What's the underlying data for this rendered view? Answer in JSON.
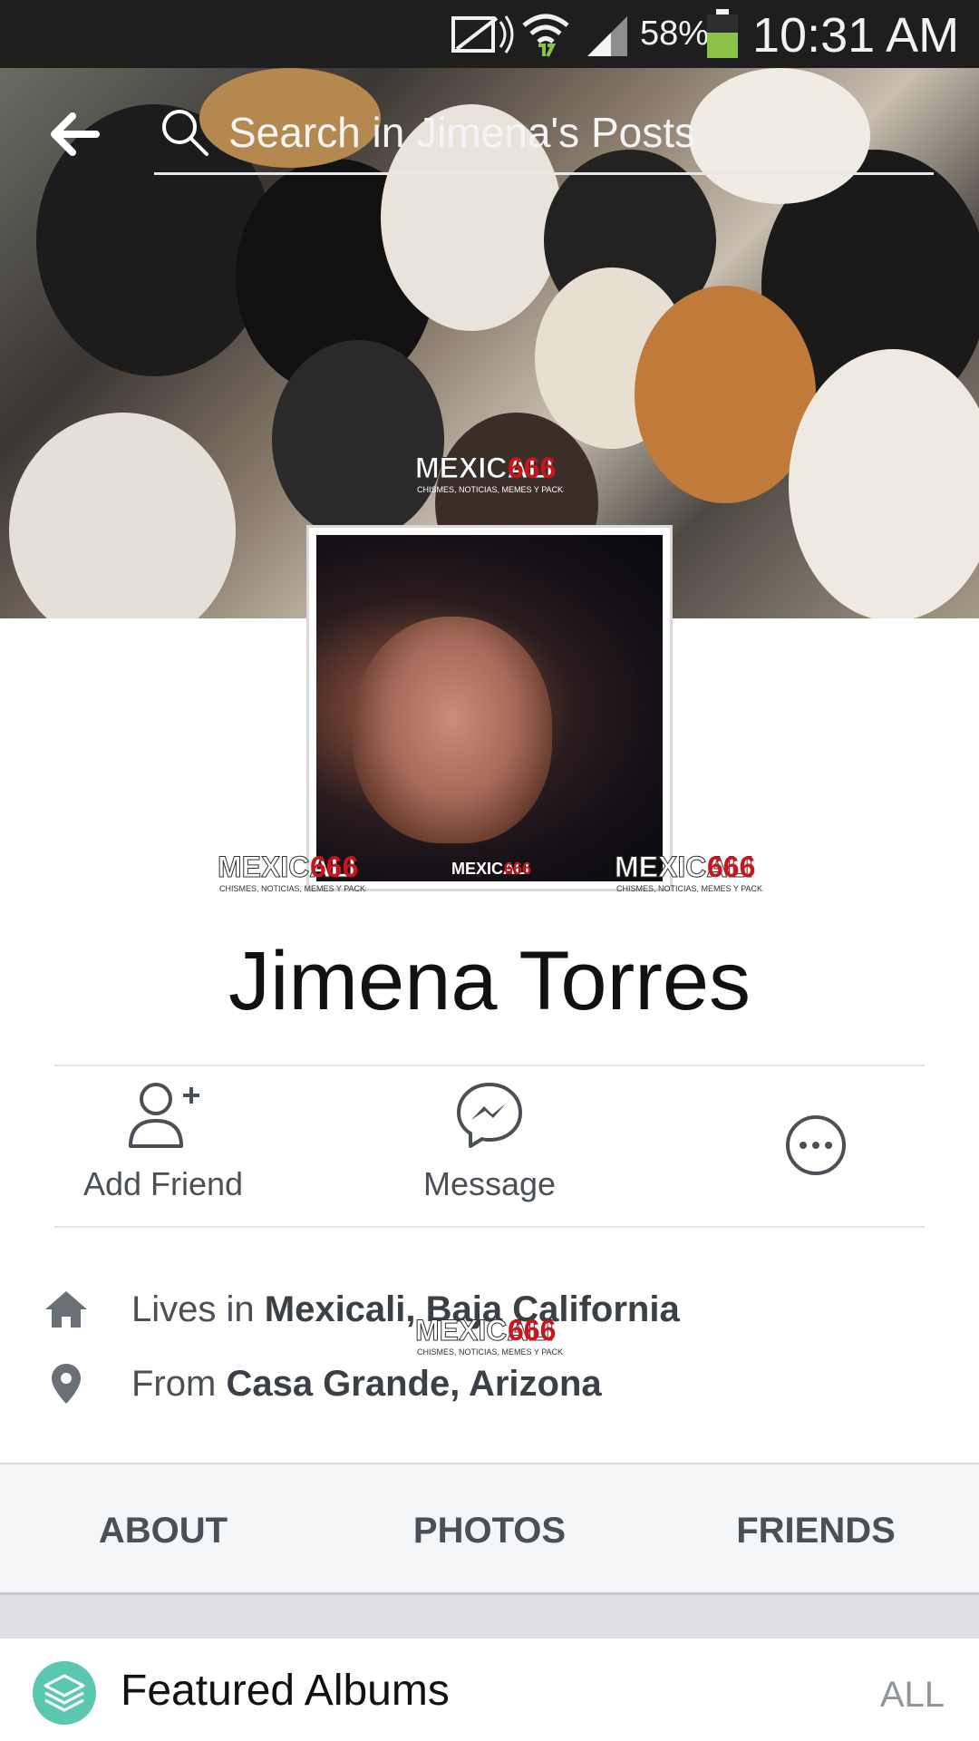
{
  "status_bar": {
    "battery_percent": "58%",
    "time": "10:31 AM",
    "icons": [
      "mute-icon",
      "wifi-icon",
      "signal-icon",
      "battery-icon"
    ]
  },
  "header": {
    "search_placeholder": "Search in Jimena's Posts",
    "back_icon": "back-arrow-icon",
    "search_icon": "search-icon"
  },
  "watermark": {
    "brand": "MEXICALI",
    "number": "666",
    "tagline": "CHISMES, NOTICIAS, MEMES Y PACKS"
  },
  "profile": {
    "name": "Jimena Torres"
  },
  "actions": [
    {
      "label": "Add Friend",
      "icon": "add-friend-icon"
    },
    {
      "label": "Message",
      "icon": "messenger-icon"
    },
    {
      "label": "",
      "icon": "more-icon"
    }
  ],
  "info": {
    "lives": {
      "prefix": "Lives in ",
      "value": "Mexicali, Baja California",
      "icon": "home-icon"
    },
    "from": {
      "prefix": "From ",
      "value": "Casa Grande, Arizona",
      "icon": "location-pin-icon"
    }
  },
  "tabs": [
    "ABOUT",
    "PHOTOS",
    "FRIENDS"
  ],
  "featured": {
    "title": "Featured Albums",
    "all_label": "ALL",
    "icon": "albums-icon"
  },
  "colors": {
    "status_bar_bg": "#1e1e1e",
    "text_primary": "#111111",
    "text_secondary": "#4b4f56",
    "tab_bg": "#f5f6f7",
    "accent_teal": "#5ac8b0",
    "watermark_red": "#d0121a"
  }
}
